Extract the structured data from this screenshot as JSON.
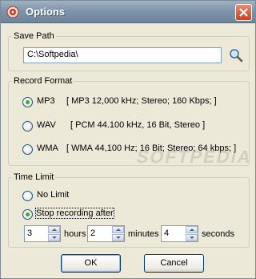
{
  "window": {
    "title": "Options"
  },
  "save_path": {
    "legend": "Save Path",
    "value": "C:\\Softpedia\\"
  },
  "record_format": {
    "legend": "Record Format",
    "options": [
      {
        "label": "MP3",
        "detail": "[ MP3 12,000 kHz; Stereo;  160 Kbps;  ]",
        "selected": true
      },
      {
        "label": "WAV",
        "detail": "[ PCM 44.100 kHz, 16 Bit, Stereo ]",
        "selected": false
      },
      {
        "label": "WMA",
        "detail": "[ WMA 44,100 Hz; 16 Bit; Stereo; 64 kbps; ]",
        "selected": false
      }
    ]
  },
  "time_limit": {
    "legend": "Time Limit",
    "options": [
      {
        "label": "No Limit",
        "selected": false
      },
      {
        "label": "Stop recording after",
        "selected": true
      }
    ],
    "hours": {
      "value": "3",
      "unit": "hours"
    },
    "minutes": {
      "value": "2",
      "unit": "minutes"
    },
    "seconds": {
      "value": "4",
      "unit": "seconds"
    }
  },
  "buttons": {
    "ok": "OK",
    "cancel": "Cancel"
  },
  "watermark": "SOFTPEDIA"
}
